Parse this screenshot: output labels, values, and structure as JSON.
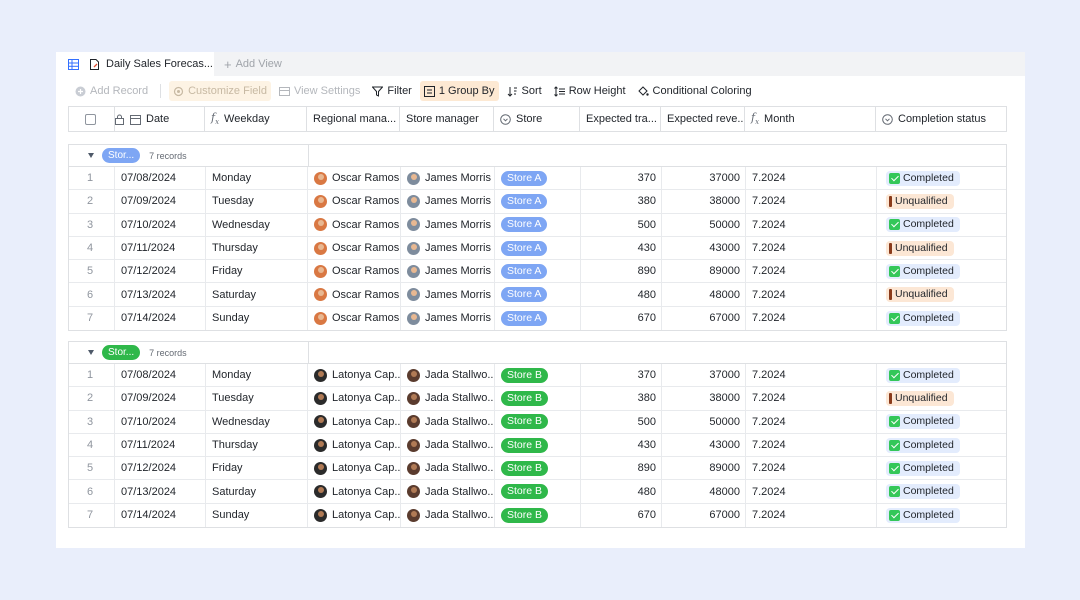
{
  "tabs": {
    "active_label": "Daily Sales Forecas...",
    "add_view_label": "Add View"
  },
  "toolbar": {
    "add_record": "Add Record",
    "customize_field": "Customize Field",
    "view_settings": "View Settings",
    "filter": "Filter",
    "group_by": "1 Group By",
    "sort": "Sort",
    "row_height": "Row Height",
    "conditional_coloring": "Conditional Coloring"
  },
  "columns": {
    "date": "Date",
    "weekday": "Weekday",
    "regional_manager": "Regional mana...",
    "store_manager": "Store manager",
    "store": "Store",
    "expected_traffic": "Expected tra...",
    "expected_revenue": "Expected reve...",
    "month": "Month",
    "completion_status": "Completion status"
  },
  "colors": {
    "store_a": "#7ea6f4",
    "store_b": "#2fb84a"
  },
  "groups": [
    {
      "label": "Stor...",
      "count": "7 records",
      "rows": [
        {
          "n": "1",
          "date": "07/08/2024",
          "weekday": "Monday",
          "regional": "Oscar Ramos",
          "manager": "James Morris",
          "store": "Store A",
          "traffic": "370",
          "revenue": "37000",
          "month": "7.2024",
          "status": "Completed"
        },
        {
          "n": "2",
          "date": "07/09/2024",
          "weekday": "Tuesday",
          "regional": "Oscar Ramos",
          "manager": "James Morris",
          "store": "Store A",
          "traffic": "380",
          "revenue": "38000",
          "month": "7.2024",
          "status": "Unqualified"
        },
        {
          "n": "3",
          "date": "07/10/2024",
          "weekday": "Wednesday",
          "regional": "Oscar Ramos",
          "manager": "James Morris",
          "store": "Store A",
          "traffic": "500",
          "revenue": "50000",
          "month": "7.2024",
          "status": "Completed"
        },
        {
          "n": "4",
          "date": "07/11/2024",
          "weekday": "Thursday",
          "regional": "Oscar Ramos",
          "manager": "James Morris",
          "store": "Store A",
          "traffic": "430",
          "revenue": "43000",
          "month": "7.2024",
          "status": "Unqualified"
        },
        {
          "n": "5",
          "date": "07/12/2024",
          "weekday": "Friday",
          "regional": "Oscar Ramos",
          "manager": "James Morris",
          "store": "Store A",
          "traffic": "890",
          "revenue": "89000",
          "month": "7.2024",
          "status": "Completed"
        },
        {
          "n": "6",
          "date": "07/13/2024",
          "weekday": "Saturday",
          "regional": "Oscar Ramos",
          "manager": "James Morris",
          "store": "Store A",
          "traffic": "480",
          "revenue": "48000",
          "month": "7.2024",
          "status": "Unqualified"
        },
        {
          "n": "7",
          "date": "07/14/2024",
          "weekday": "Sunday",
          "regional": "Oscar Ramos",
          "manager": "James Morris",
          "store": "Store A",
          "traffic": "670",
          "revenue": "67000",
          "month": "7.2024",
          "status": "Completed"
        }
      ]
    },
    {
      "label": "Stor...",
      "count": "7 records",
      "rows": [
        {
          "n": "1",
          "date": "07/08/2024",
          "weekday": "Monday",
          "regional": "Latonya Cap...",
          "manager": "Jada Stallwo...",
          "store": "Store B",
          "traffic": "370",
          "revenue": "37000",
          "month": "7.2024",
          "status": "Completed"
        },
        {
          "n": "2",
          "date": "07/09/2024",
          "weekday": "Tuesday",
          "regional": "Latonya Cap...",
          "manager": "Jada Stallwo...",
          "store": "Store B",
          "traffic": "380",
          "revenue": "38000",
          "month": "7.2024",
          "status": "Unqualified"
        },
        {
          "n": "3",
          "date": "07/10/2024",
          "weekday": "Wednesday",
          "regional": "Latonya Cap...",
          "manager": "Jada Stallwo...",
          "store": "Store B",
          "traffic": "500",
          "revenue": "50000",
          "month": "7.2024",
          "status": "Completed"
        },
        {
          "n": "4",
          "date": "07/11/2024",
          "weekday": "Thursday",
          "regional": "Latonya Cap...",
          "manager": "Jada Stallwo...",
          "store": "Store B",
          "traffic": "430",
          "revenue": "43000",
          "month": "7.2024",
          "status": "Completed"
        },
        {
          "n": "5",
          "date": "07/12/2024",
          "weekday": "Friday",
          "regional": "Latonya Cap...",
          "manager": "Jada Stallwo...",
          "store": "Store B",
          "traffic": "890",
          "revenue": "89000",
          "month": "7.2024",
          "status": "Completed"
        },
        {
          "n": "6",
          "date": "07/13/2024",
          "weekday": "Saturday",
          "regional": "Latonya Cap...",
          "manager": "Jada Stallwo...",
          "store": "Store B",
          "traffic": "480",
          "revenue": "48000",
          "month": "7.2024",
          "status": "Completed"
        },
        {
          "n": "7",
          "date": "07/14/2024",
          "weekday": "Sunday",
          "regional": "Latonya Cap...",
          "manager": "Jada Stallwo...",
          "store": "Store B",
          "traffic": "670",
          "revenue": "67000",
          "month": "7.2024",
          "status": "Completed"
        }
      ]
    }
  ]
}
